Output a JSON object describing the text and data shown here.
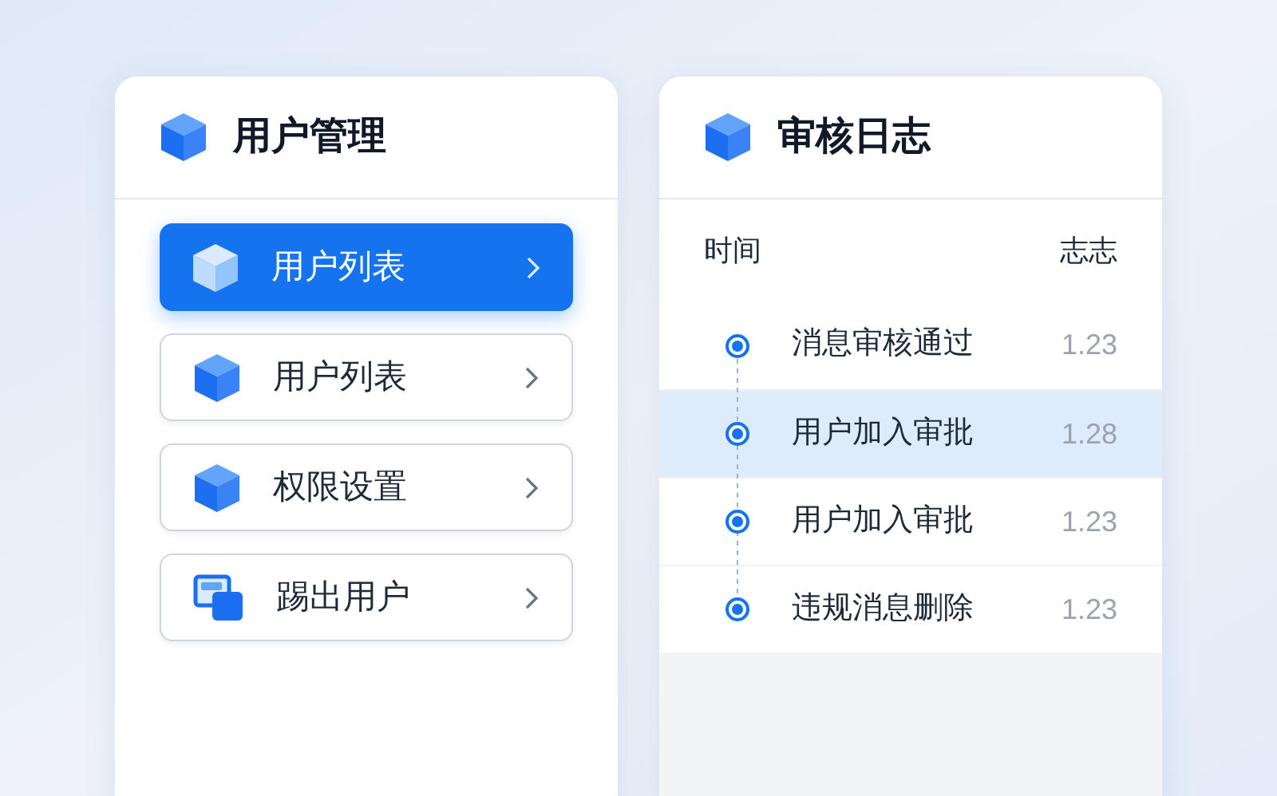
{
  "user_panel": {
    "title": "用户管理",
    "items": [
      {
        "label": "用户列表",
        "kind": "cube",
        "selected": true
      },
      {
        "label": "用户列表",
        "kind": "cube",
        "selected": false
      },
      {
        "label": "权限设置",
        "kind": "cube",
        "selected": false
      },
      {
        "label": "踢出用户",
        "kind": "windows",
        "selected": false
      }
    ]
  },
  "log_panel": {
    "title": "审核日志",
    "columns": [
      "时间",
      "志志"
    ],
    "rows": [
      {
        "event": "消息审核通过",
        "value": "1.23",
        "selected": false
      },
      {
        "event": "用户加入审批",
        "value": "1.28",
        "selected": true
      },
      {
        "event": "用户加入审批",
        "value": "1.23",
        "selected": false
      },
      {
        "event": "违规消息删除",
        "value": "1.23",
        "selected": false
      }
    ]
  }
}
